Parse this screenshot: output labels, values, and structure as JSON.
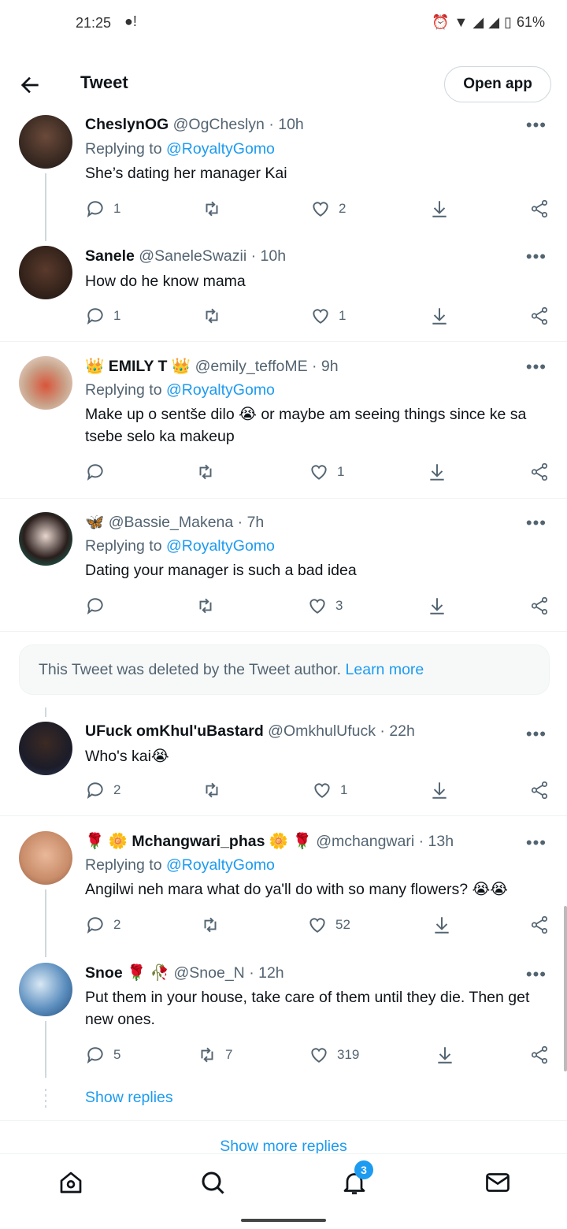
{
  "status_bar": {
    "time": "21:25",
    "battery": "61%"
  },
  "header": {
    "title": "Tweet",
    "open_app": "Open app"
  },
  "tweets": [
    {
      "name": "CheslynOG",
      "handle": "@OgCheslyn",
      "time": "· 10h",
      "replying_label": "Replying to",
      "replying_to": "@RoyaltyGomo",
      "text": "She’s dating her manager Kai",
      "replies": "1",
      "retweets": "",
      "likes": "2"
    },
    {
      "name": "Sanele",
      "handle": "@SaneleSwazii",
      "time": "· 10h",
      "text": "How do he know mama",
      "replies": "1",
      "retweets": "",
      "likes": "1"
    },
    {
      "name": "👑 EMILY T 👑",
      "handle": "@emily_teffoME",
      "time": "· 9h",
      "replying_label": "Replying to",
      "replying_to": "@RoyaltyGomo",
      "text": "Make up o sentše dilo 😭 or maybe am seeing things since ke sa tsebe selo ka makeup",
      "replies": "",
      "retweets": "",
      "likes": "1"
    },
    {
      "name": "🦋",
      "handle": "@Bassie_Makena",
      "time": "· 7h",
      "replying_label": "Replying to",
      "replying_to": "@RoyaltyGomo",
      "text": "Dating your manager is such a bad idea",
      "replies": "",
      "retweets": "",
      "likes": "3"
    },
    {
      "name": "UFuck omKhul'uBastard",
      "handle": "@OmkhulUfuck",
      "time": "· 22h",
      "text": "Who's kai😭",
      "replies": "2",
      "retweets": "",
      "likes": "1"
    },
    {
      "name": "🌹 🌼 Mchangwari_phas 🌼 🌹",
      "handle": "@mchangwari",
      "time": "· 13h",
      "replying_label": "Replying to",
      "replying_to": "@RoyaltyGomo",
      "text": "Angilwi neh mara what do ya'll do with so many flowers? 😭😭",
      "replies": "2",
      "retweets": "",
      "likes": "52"
    },
    {
      "name": "Snoe 🌹 🥀",
      "handle": "@Snoe_N",
      "time": "· 12h",
      "text": "Put them in your house, take care of them until they die. Then get new ones.",
      "replies": "5",
      "retweets": "7",
      "likes": "319"
    }
  ],
  "deleted_notice": {
    "text": "This Tweet was deleted by the Tweet author.",
    "link": "Learn more"
  },
  "show_replies": "Show replies",
  "show_more_replies": "Show more replies",
  "bottom_nav": {
    "notification_badge": "3"
  },
  "colors": {
    "accent": "#1d9bf0",
    "text": "#0f1419",
    "muted": "#536471"
  }
}
